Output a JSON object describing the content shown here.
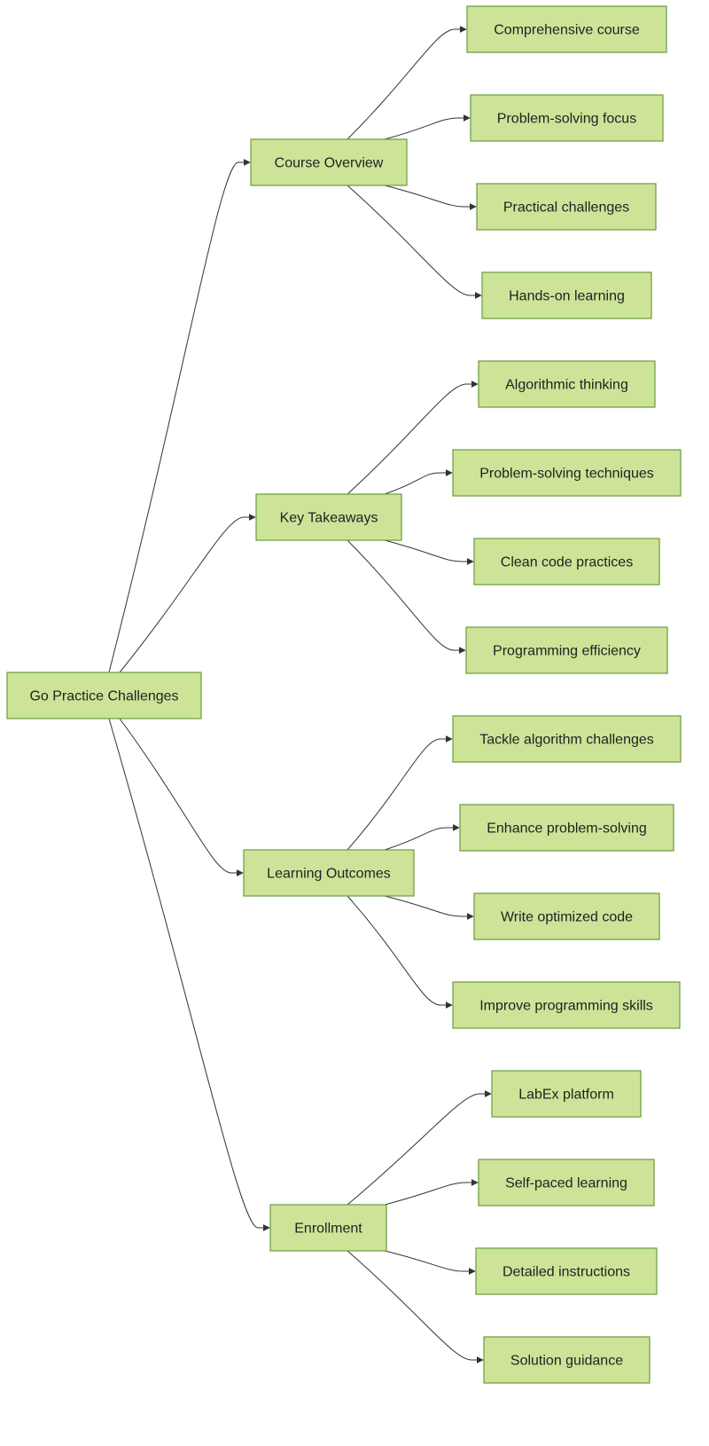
{
  "diagram": {
    "type": "mindmap-flowchart",
    "direction": "left-to-right",
    "colors": {
      "node_fill": "#cde498",
      "node_border": "#6b9a3f",
      "edge": "#333333",
      "text": "#222222",
      "background": "#ffffff"
    },
    "root": {
      "id": "root",
      "label": "Go Practice Challenges"
    },
    "branches": [
      {
        "id": "course-overview",
        "label": "Course Overview",
        "children": [
          {
            "id": "comprehensive-course",
            "label": "Comprehensive course"
          },
          {
            "id": "problem-solving-focus",
            "label": "Problem-solving focus"
          },
          {
            "id": "practical-challenges",
            "label": "Practical challenges"
          },
          {
            "id": "hands-on-learning",
            "label": "Hands-on learning"
          }
        ]
      },
      {
        "id": "key-takeaways",
        "label": "Key Takeaways",
        "children": [
          {
            "id": "algorithmic-thinking",
            "label": "Algorithmic thinking"
          },
          {
            "id": "problem-solving-techniques",
            "label": "Problem-solving techniques"
          },
          {
            "id": "clean-code-practices",
            "label": "Clean code practices"
          },
          {
            "id": "programming-efficiency",
            "label": "Programming efficiency"
          }
        ]
      },
      {
        "id": "learning-outcomes",
        "label": "Learning Outcomes",
        "children": [
          {
            "id": "tackle-algorithm-challenges",
            "label": "Tackle algorithm challenges"
          },
          {
            "id": "enhance-problem-solving",
            "label": "Enhance problem-solving"
          },
          {
            "id": "write-optimized-code",
            "label": "Write optimized code"
          },
          {
            "id": "improve-programming-skills",
            "label": "Improve programming skills"
          }
        ]
      },
      {
        "id": "enrollment",
        "label": "Enrollment",
        "children": [
          {
            "id": "labex-platform",
            "label": "LabEx platform"
          },
          {
            "id": "self-paced-learning",
            "label": "Self-paced learning"
          },
          {
            "id": "detailed-instructions",
            "label": "Detailed instructions"
          },
          {
            "id": "solution-guidance",
            "label": "Solution guidance"
          }
        ]
      }
    ]
  }
}
